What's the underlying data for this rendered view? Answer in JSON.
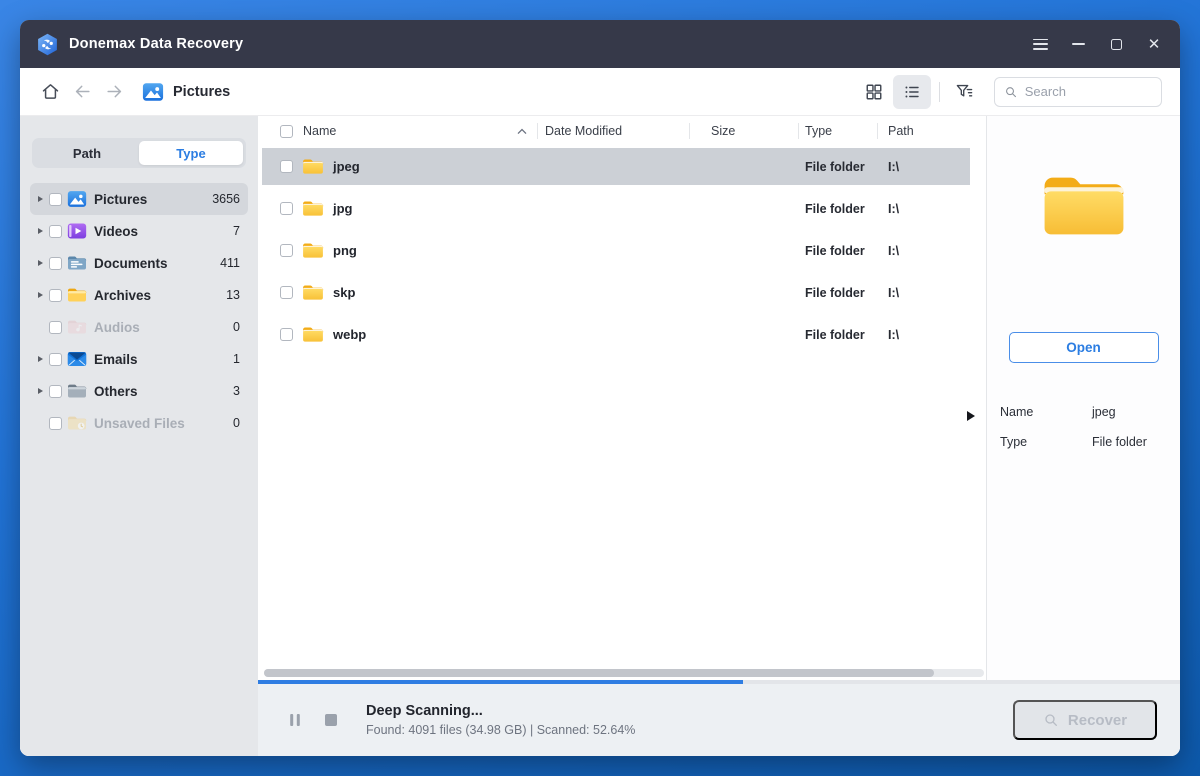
{
  "window": {
    "title": "Donemax Data Recovery"
  },
  "toolbar": {
    "breadcrumb": "Pictures",
    "search_placeholder": "Search"
  },
  "sidebar": {
    "tabs": [
      {
        "id": "path",
        "label": "Path",
        "active": false
      },
      {
        "id": "type",
        "label": "Type",
        "active": true
      }
    ],
    "items": [
      {
        "id": "pictures",
        "label": "Pictures",
        "count": 3656,
        "icon": "pictures-icon",
        "selected": true,
        "disabled": false,
        "expandable": true
      },
      {
        "id": "videos",
        "label": "Videos",
        "count": 7,
        "icon": "videos-icon",
        "selected": false,
        "disabled": false,
        "expandable": true
      },
      {
        "id": "documents",
        "label": "Documents",
        "count": 411,
        "icon": "documents-icon",
        "selected": false,
        "disabled": false,
        "expandable": true
      },
      {
        "id": "archives",
        "label": "Archives",
        "count": 13,
        "icon": "archives-icon",
        "selected": false,
        "disabled": false,
        "expandable": true
      },
      {
        "id": "audios",
        "label": "Audios",
        "count": 0,
        "icon": "audios-icon",
        "selected": false,
        "disabled": true,
        "expandable": false
      },
      {
        "id": "emails",
        "label": "Emails",
        "count": 1,
        "icon": "emails-icon",
        "selected": false,
        "disabled": false,
        "expandable": true
      },
      {
        "id": "others",
        "label": "Others",
        "count": 3,
        "icon": "others-icon",
        "selected": false,
        "disabled": false,
        "expandable": true
      },
      {
        "id": "unsaved-files",
        "label": "Unsaved Files",
        "count": 0,
        "icon": "unsaved-icon",
        "selected": false,
        "disabled": true,
        "expandable": false
      }
    ]
  },
  "filelist": {
    "columns": [
      "Name",
      "Date Modified",
      "Size",
      "Type",
      "Path"
    ],
    "sort": {
      "column": "Name",
      "direction": "asc"
    },
    "rows": [
      {
        "name": "jpeg",
        "date_modified": "",
        "size": "",
        "type": "File folder",
        "path": "I:\\",
        "icon": "folder-icon",
        "selected": true
      },
      {
        "name": "jpg",
        "date_modified": "",
        "size": "",
        "type": "File folder",
        "path": "I:\\",
        "icon": "folder-icon",
        "selected": false
      },
      {
        "name": "png",
        "date_modified": "",
        "size": "",
        "type": "File folder",
        "path": "I:\\",
        "icon": "folder-icon",
        "selected": false
      },
      {
        "name": "skp",
        "date_modified": "",
        "size": "",
        "type": "File folder",
        "path": "I:\\",
        "icon": "folder-icon",
        "selected": false
      },
      {
        "name": "webp",
        "date_modified": "",
        "size": "",
        "type": "File folder",
        "path": "I:\\",
        "icon": "folder-icon",
        "selected": false
      }
    ]
  },
  "preview": {
    "open_label": "Open",
    "fields": [
      {
        "label": "Name",
        "value": "jpeg"
      },
      {
        "label": "Type",
        "value": "File folder"
      }
    ]
  },
  "statusbar": {
    "status_title": "Deep Scanning...",
    "status_detail": "Found: 4091 files (34.98 GB) | Scanned: 52.64%",
    "recover_label": "Recover",
    "progress_percent": 52.64
  },
  "colors": {
    "accent_blue": "#2b7de2",
    "titlebar_bg": "#363949",
    "selected_row": "#ccd0d6",
    "sidebar_bg": "#e5e7ea",
    "progress_fill": "#2f7de2",
    "folder_yellow": "#ffd158"
  }
}
